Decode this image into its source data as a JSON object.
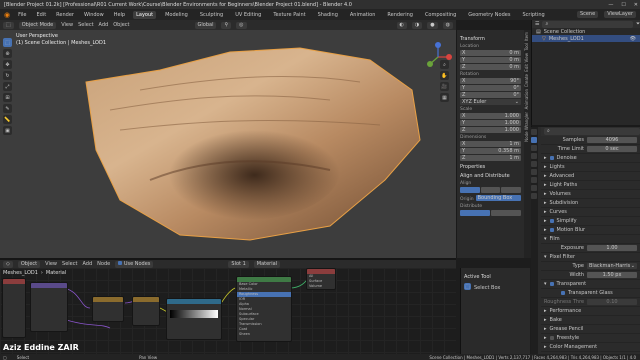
{
  "window": {
    "title": "[Blender Project 01.2k] [Professional\\R01 Current Work\\Course\\Blender Environments for Beginners\\Blender Project 01.blend] - Blender 4.0"
  },
  "menubar": {
    "items": [
      "File",
      "Edit",
      "Render",
      "Window",
      "Help"
    ],
    "workspaces": [
      "Layout",
      "Modeling",
      "Sculpting",
      "UV Editing",
      "Texture Paint",
      "Shading",
      "Animation",
      "Rendering",
      "Compositing",
      "Geometry Nodes",
      "Scripting"
    ],
    "active_workspace": "Layout",
    "scene": "Scene",
    "view_layer": "ViewLayer"
  },
  "viewport": {
    "mode": "Object Mode",
    "menus": [
      "View",
      "Select",
      "Add",
      "Object"
    ],
    "orientation": "Global",
    "overlay_text_1": "User Perspective",
    "overlay_text_2": "(1) Scene Collection | Meshes_LOD1"
  },
  "npanel": {
    "transform_title": "Transform",
    "location_label": "Location",
    "location": [
      {
        "axis": "X",
        "value": "0 m"
      },
      {
        "axis": "Y",
        "value": "0 m"
      },
      {
        "axis": "Z",
        "value": "0 m"
      }
    ],
    "rotation_label": "Rotation",
    "rotation": [
      {
        "axis": "X",
        "value": "90°"
      },
      {
        "axis": "Y",
        "value": "0°"
      },
      {
        "axis": "Z",
        "value": "0°"
      }
    ],
    "rotation_mode": "XYZ Euler",
    "scale_label": "Scale",
    "scale": [
      {
        "axis": "X",
        "value": "1.000"
      },
      {
        "axis": "Y",
        "value": "1.000"
      },
      {
        "axis": "Z",
        "value": "1.000"
      }
    ],
    "dimensions_label": "Dimensions",
    "dimensions": [
      {
        "axis": "X",
        "value": "1 m"
      },
      {
        "axis": "Y",
        "value": "0.358 m"
      },
      {
        "axis": "Z",
        "value": "1 m"
      }
    ],
    "properties_title": "Properties",
    "align_title": "Align and Distribute",
    "align_label": "Align",
    "origin_label": "Origin",
    "bounding_box": "Bounding Box",
    "distribute_label": "Distribute",
    "tabs": [
      "Item",
      "Tool",
      "View",
      "Edit",
      "Create",
      "Animation",
      "Node Wrangler"
    ]
  },
  "outliner": {
    "root": "Scene Collection",
    "items": [
      "Meshes_LOD1"
    ]
  },
  "properties": {
    "samples_label": "Samples",
    "samples_value": "4096",
    "time_limit_label": "Time Limit",
    "time_limit_value": "0 sec",
    "denoise": "Denoise",
    "sections": [
      "Lights",
      "Advanced",
      "Light Paths",
      "Volumes",
      "Subdivision",
      "Curves",
      "Simplify",
      "Motion Blur",
      "Film"
    ],
    "exposure_label": "Exposure",
    "exposure_value": "1.00",
    "pixel_filter": "Pixel Filter",
    "filter_type_label": "Type",
    "filter_type_value": "Blackman-Harris",
    "width_label": "Width",
    "width_value": "1.50 px",
    "transparent": "Transparent",
    "transparent_glass": "Transparent Glass",
    "roughness_threshold": "Roughness Thres...",
    "roughness_value": "0.10",
    "bottom_sections": [
      "Performance",
      "Bake",
      "Grease Pencil",
      "Freestyle",
      "Color Management"
    ]
  },
  "node_editor": {
    "editor_type": "Object",
    "menus": [
      "View",
      "Select",
      "Add",
      "Node"
    ],
    "use_nodes": "Use Nodes",
    "slot": "Slot 1",
    "material": "Material",
    "breadcrumb": [
      "Meshes_LOD1",
      "Material"
    ],
    "nodes": [
      {
        "title": "Texture Coordinate",
        "color": "#8b3d3d"
      },
      {
        "title": "Mapping",
        "color": "#5a4a8a"
      },
      {
        "title": "Image Texture",
        "color": "#8a6b2d"
      },
      {
        "title": "Principled BSDF",
        "color": "#3f7a45"
      },
      {
        "title": "Color Ramp",
        "color": "#2f6a8a"
      },
      {
        "title": "Material Output",
        "color": "#8b3d3d"
      }
    ],
    "bsdf_sockets": [
      "Base Color",
      "Metallic",
      "Roughness",
      "IOR",
      "Alpha",
      "Normal",
      "Subsurface",
      "Specular",
      "Transmission",
      "Coat",
      "Sheen",
      "Emission"
    ],
    "output_sockets": [
      "All",
      "Surface",
      "Volume",
      "Displacement"
    ]
  },
  "ne_side": {
    "title": "Active Tool",
    "tool": "Select Box"
  },
  "status": {
    "left": "Select",
    "middle": "Pan View",
    "right": "Scene Collection | Meshes_LOD1 | Verts 2,137,717 | Faces 4,264,983 | Tris 4,264,983 | Objects 1/1 | 4.0"
  },
  "watermark": "Aziz Eddine ZAIR"
}
